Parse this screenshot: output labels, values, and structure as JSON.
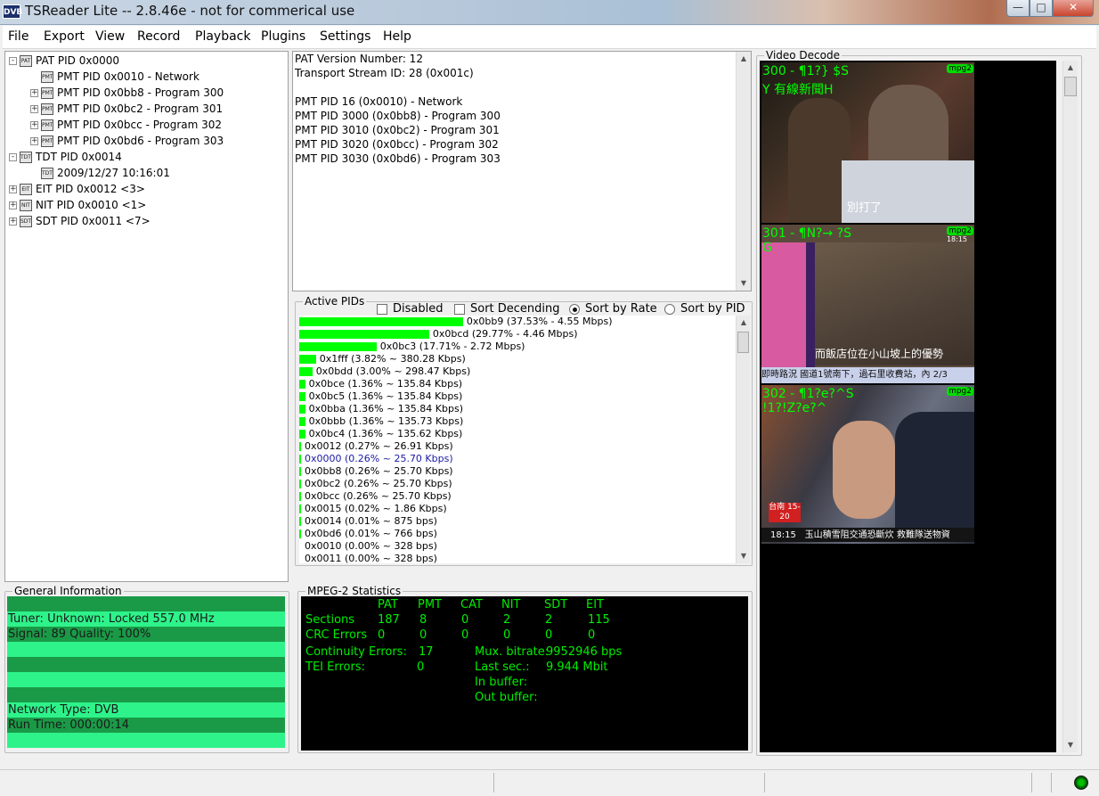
{
  "window": {
    "title": "TSReader Lite -- 2.8.46e - not for commerical use",
    "app_icon": "DVB"
  },
  "menu": [
    "File",
    "Export",
    "View",
    "Record",
    "Playback",
    "Plugins",
    "Settings",
    "Help"
  ],
  "tree": [
    {
      "indent": 0,
      "expander": "-",
      "node": "PAT",
      "label": "PAT PID 0x0000"
    },
    {
      "indent": 1,
      "expander": "",
      "node": "PMT",
      "label": "PMT PID 0x0010 - Network"
    },
    {
      "indent": 1,
      "expander": "+",
      "node": "PMT",
      "label": "PMT PID 0x0bb8 - Program 300"
    },
    {
      "indent": 1,
      "expander": "+",
      "node": "PMT",
      "label": "PMT PID 0x0bc2 - Program 301"
    },
    {
      "indent": 1,
      "expander": "+",
      "node": "PMT",
      "label": "PMT PID 0x0bcc - Program 302"
    },
    {
      "indent": 1,
      "expander": "+",
      "node": "PMT",
      "label": "PMT PID 0x0bd6 - Program 303"
    },
    {
      "indent": 0,
      "expander": "-",
      "node": "TDT",
      "label": "TDT PID 0x0014"
    },
    {
      "indent": 1,
      "expander": "",
      "node": "TDT",
      "label": "2009/12/27 10:16:01"
    },
    {
      "indent": 0,
      "expander": "+",
      "node": "EIT",
      "label": "EIT PID 0x0012 <3>"
    },
    {
      "indent": 0,
      "expander": "+",
      "node": "NIT",
      "label": "NIT PID 0x0010 <1>"
    },
    {
      "indent": 0,
      "expander": "+",
      "node": "SDT",
      "label": "SDT PID 0x0011 <7>"
    }
  ],
  "info_lines": [
    "PAT Version Number: 12",
    "Transport Stream ID: 28 (0x001c)",
    "",
    "PMT PID 16 (0x0010) - Network",
    "PMT PID 3000 (0x0bb8) - Program 300",
    "PMT PID 3010 (0x0bc2) - Program 301",
    "PMT PID 3020 (0x0bcc) - Program 302",
    "PMT PID 3030 (0x0bd6) - Program 303"
  ],
  "active_pids": {
    "title": "Active PIDs",
    "options": {
      "disabled": {
        "label": "Disabled",
        "checked": false
      },
      "sort_descending": {
        "label": "Sort Decending",
        "checked": false
      },
      "sort_by_rate": {
        "label": "Sort by Rate",
        "selected": true
      },
      "sort_by_pid": {
        "label": "Sort by PID",
        "selected": false
      }
    },
    "rows": [
      {
        "percent": 37.53,
        "label": "0x0bb9 (37.53% - 4.55 Mbps)"
      },
      {
        "percent": 29.77,
        "label": "0x0bcd (29.77% - 4.46 Mbps)"
      },
      {
        "percent": 17.71,
        "label": "0x0bc3 (17.71% - 2.72 Mbps)"
      },
      {
        "percent": 3.82,
        "label": "0x1fff (3.82% ~ 380.28 Kbps)"
      },
      {
        "percent": 3.0,
        "label": "0x0bdd (3.00% ~ 298.47 Kbps)"
      },
      {
        "percent": 1.36,
        "label": "0x0bce (1.36% ~ 135.84 Kbps)"
      },
      {
        "percent": 1.36,
        "label": "0x0bc5 (1.36% ~ 135.84 Kbps)"
      },
      {
        "percent": 1.36,
        "label": "0x0bba (1.36% ~ 135.84 Kbps)"
      },
      {
        "percent": 1.36,
        "label": "0x0bbb (1.36% ~ 135.73 Kbps)"
      },
      {
        "percent": 1.36,
        "label": "0x0bc4 (1.36% ~ 135.62 Kbps)"
      },
      {
        "percent": 0.27,
        "label": "0x0012 (0.27% ~ 26.91 Kbps)"
      },
      {
        "percent": 0.26,
        "label": "0x0000 (0.26% ~ 25.70 Kbps)",
        "color": "#1a1aa6"
      },
      {
        "percent": 0.26,
        "label": "0x0bb8 (0.26% ~ 25.70 Kbps)"
      },
      {
        "percent": 0.26,
        "label": "0x0bc2 (0.26% ~ 25.70 Kbps)"
      },
      {
        "percent": 0.26,
        "label": "0x0bcc (0.26% ~ 25.70 Kbps)"
      },
      {
        "percent": 0.02,
        "label": "0x0015 (0.02% ~ 1.86 Kbps)"
      },
      {
        "percent": 0.01,
        "label": "0x0014 (0.01% ~ 875 bps)"
      },
      {
        "percent": 0.01,
        "label": "0x0bd6 (0.01% ~ 766 bps)"
      },
      {
        "percent": 0.0,
        "label": "0x0010 (0.00% ~ 328 bps)"
      },
      {
        "percent": 0.0,
        "label": "0x0011 (0.00% ~ 328 bps)"
      }
    ]
  },
  "general": {
    "title": "General Information",
    "rows": [
      "",
      "Tuner: Unknown: Locked 557.0 MHz",
      "Signal: 89 Quality: 100%",
      "",
      "",
      "",
      "",
      "Network Type: DVB",
      "Run Time: 000:00:14",
      ""
    ]
  },
  "mpeg": {
    "title": "MPEG-2 Statistics",
    "columns": [
      "PAT",
      "PMT",
      "CAT",
      "NIT",
      "SDT",
      "EIT"
    ],
    "sections_label": "Sections",
    "sections": [
      "187",
      "8",
      "0",
      "2",
      "2",
      "115"
    ],
    "crc_label": "CRC Errors",
    "crc": [
      "0",
      "0",
      "0",
      "0",
      "0",
      "0"
    ],
    "continuity_label": "Continuity Errors:",
    "continuity": "17",
    "tei_label": "TEI Errors:",
    "tei": "0",
    "mux_label": "Mux. bitrate:",
    "mux": "9952946 bps",
    "last_label": "Last sec.:",
    "last": "9.944 Mbit",
    "in_buffer_label": "In buffer:",
    "out_buffer_label": "Out buffer:"
  },
  "video": {
    "title": "Video Decode",
    "frames": [
      {
        "osd1": "300 - ¶1?}   $S",
        "osd2": "Y 有線新聞H",
        "badge": "mpg2",
        "caption": "別打了"
      },
      {
        "osd1": "301 - ¶N?→   ?S",
        "osd2": "G",
        "badge": "mpg2",
        "caption": "而飯店位在小山坡上的優勢",
        "ticker": "即時路況   國道1號南下，過石里收費站，內 2/3",
        "time": "18:15"
      },
      {
        "osd1": "302 - ¶1?e?^S",
        "osd2": "!1?!Z?e?^",
        "badge": "mpg2",
        "caption": "玉山積雪阻交通恐斷炊 救難隊送物資",
        "time": "18:15",
        "weather": "台南 15-20"
      }
    ]
  }
}
